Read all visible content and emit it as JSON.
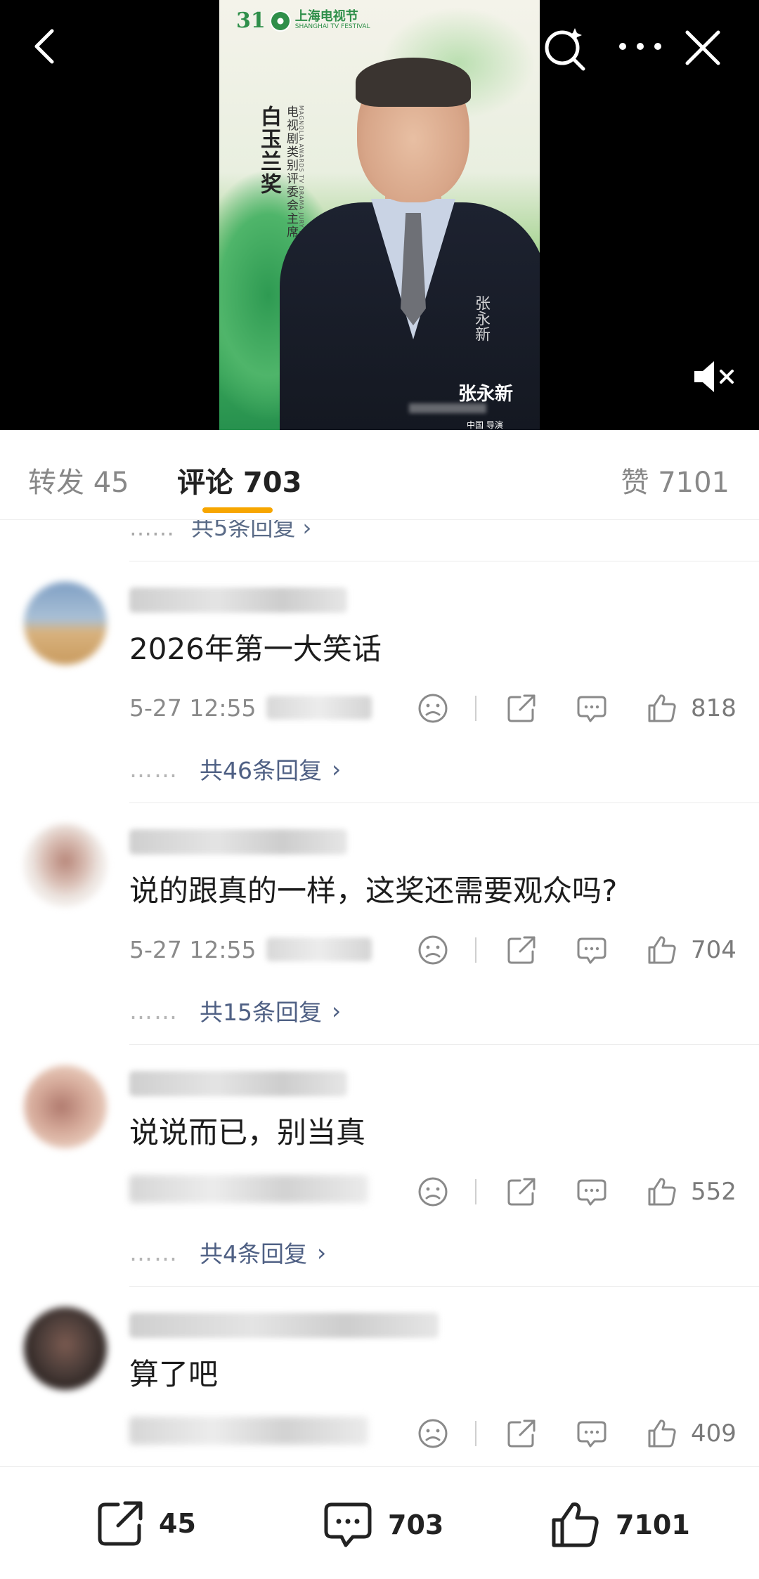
{
  "video": {
    "logo_number": "31",
    "logo_cn": "上海电视节",
    "logo_en": "SHANGHAI TV FESTIVAL",
    "award_title": "白玉兰奖",
    "role_title": "电视剧类别评委会主席",
    "role_en": "MAGNOLIA AWARDS TV DRAMA JURY PRESIDENT",
    "signature": "张永新",
    "person_name": "张永新",
    "person_sub": "中国 导演"
  },
  "tabs": {
    "repost": "转发 45",
    "comments": "评论 703",
    "likes": "赞 7101"
  },
  "partial_reply": {
    "dots": "……",
    "text": "共5条回复 ›"
  },
  "comments": [
    {
      "text": "2026年第一大笑话",
      "time": "5-27 12:55",
      "likes": "818",
      "replies": "共46条回复",
      "avatar_colors": [
        "#7f9fc4",
        "#d8b27e"
      ]
    },
    {
      "text": "说的跟真的一样，这奖还需要观众吗?",
      "time": "5-27 12:55",
      "likes": "704",
      "replies": "共15条回复",
      "avatar_colors": [
        "#efe9e5",
        "#b8877a"
      ]
    },
    {
      "text": "说说而已，别当真",
      "time": "",
      "likes": "552",
      "replies": "共4条回复",
      "avatar_colors": [
        "#e4c3b3",
        "#b07a6e"
      ]
    },
    {
      "text": "算了吧",
      "time": "",
      "likes": "409",
      "replies": "",
      "avatar_colors": [
        "#3a2f2c",
        "#7a5a50"
      ]
    }
  ],
  "bottom_bar": {
    "share_count": "45",
    "comment_count": "703",
    "like_count": "7101"
  },
  "colors": {
    "accent_underline": "#f7a600",
    "reply_link": "#4f6084",
    "poster_green": "#2f8f4a"
  },
  "icons": [
    "back-icon",
    "search-icon",
    "more-icon",
    "close-icon",
    "mute-icon",
    "dislike-icon",
    "share-icon",
    "comment-icon",
    "like-icon"
  ]
}
